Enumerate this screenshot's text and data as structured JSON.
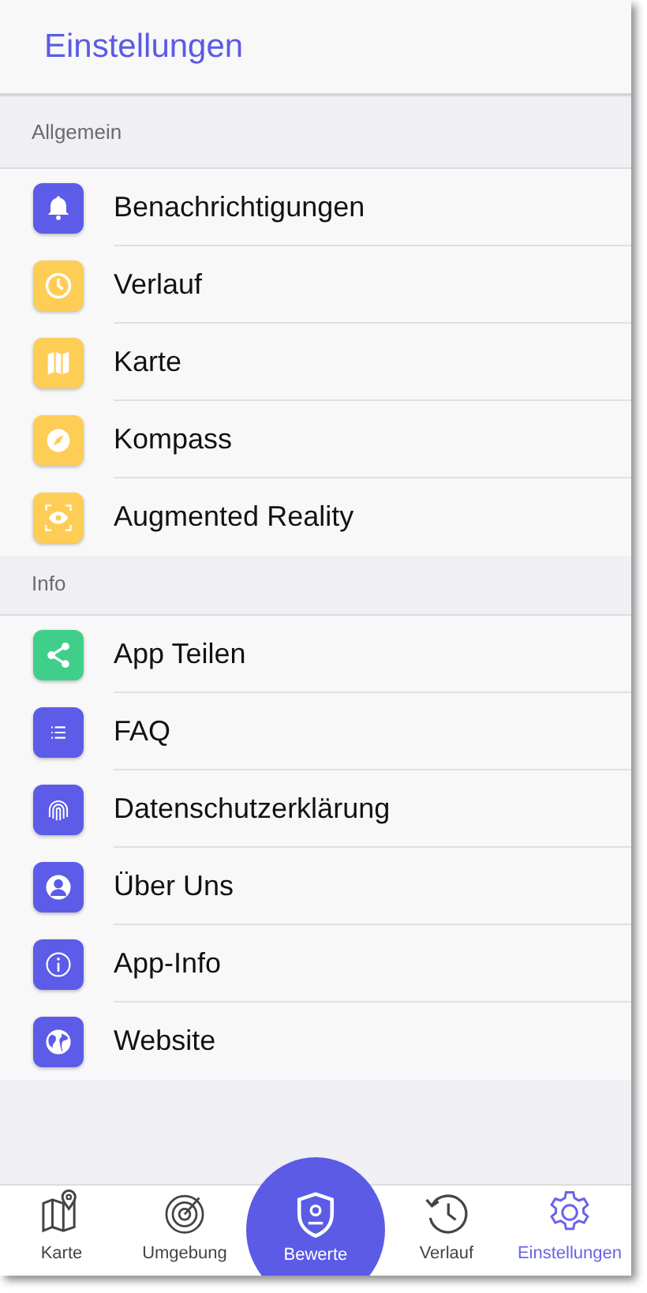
{
  "header": {
    "title": "Einstellungen"
  },
  "sections": [
    {
      "title": "Allgemein",
      "items": [
        {
          "label": "Benachrichtigungen",
          "color": "#5c5ce8"
        },
        {
          "label": "Verlauf",
          "color": "#fdcd56"
        },
        {
          "label": "Karte",
          "color": "#fdcd56"
        },
        {
          "label": "Kompass",
          "color": "#fdcd56"
        },
        {
          "label": "Augmented Reality",
          "color": "#fdcd56"
        }
      ]
    },
    {
      "title": "Info",
      "items": [
        {
          "label": "App Teilen",
          "color": "#3fcf8a"
        },
        {
          "label": "FAQ",
          "color": "#5c5ce8"
        },
        {
          "label": "Datenschutzerklärung",
          "color": "#5c5ce8"
        },
        {
          "label": "Über Uns",
          "color": "#5c5ce8"
        },
        {
          "label": "App-Info",
          "color": "#5c5ce8"
        },
        {
          "label": "Website",
          "color": "#5c5ce8"
        }
      ]
    }
  ],
  "tabs": [
    {
      "label": "Karte",
      "kind": "plain",
      "selected": false
    },
    {
      "label": "Umgebung",
      "kind": "plain",
      "selected": false
    },
    {
      "label": "Bewerte",
      "kind": "center",
      "selected": false
    },
    {
      "label": "Verlauf",
      "kind": "plain",
      "selected": false
    },
    {
      "label": "Einstellungen",
      "kind": "plain",
      "selected": true
    }
  ]
}
